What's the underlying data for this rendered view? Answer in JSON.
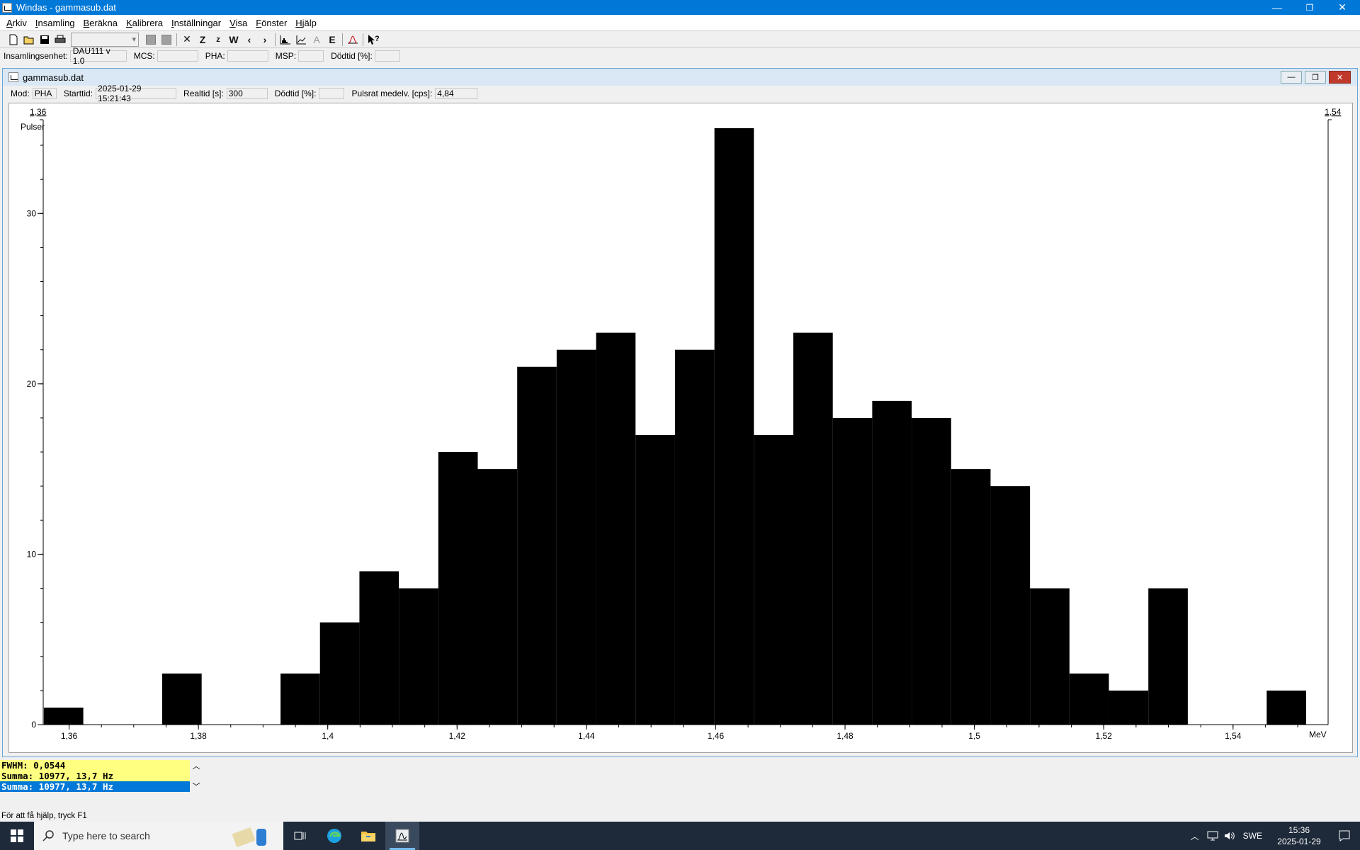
{
  "window": {
    "title": "Windas - gammasub.dat",
    "controls": {
      "minimize": "—",
      "restore": "❐",
      "close": "✕"
    }
  },
  "menu": [
    {
      "label": "Arkiv",
      "key": "A",
      "rest": "rkiv"
    },
    {
      "label": "Insamling",
      "key": "I",
      "rest": "nsamling"
    },
    {
      "label": "Beräkna",
      "key": "B",
      "rest": "eräkna"
    },
    {
      "label": "Kalibrera",
      "key": "K",
      "rest": "alibrera"
    },
    {
      "label": "Inställningar",
      "key": "I",
      "rest": "nställningar"
    },
    {
      "label": "Visa",
      "key": "V",
      "rest": "isa"
    },
    {
      "label": "Fönster",
      "key": "F",
      "rest": "önster"
    },
    {
      "label": "Hjälp",
      "key": "H",
      "rest": "jälp"
    }
  ],
  "toolbar": {
    "glyphs": {
      "x": "✕",
      "Z": "Z",
      "z": "z",
      "W": "W",
      "lt": "‹",
      "gt": "›",
      "A": "A",
      "E": "E",
      "help": "?"
    }
  },
  "infobar": {
    "unit_label": "Insamlingsenhet:",
    "unit_value": "DAU111 v 1.0",
    "mcs_label": "MCS:",
    "mcs_value": "",
    "pha_label": "PHA:",
    "pha_value": "",
    "msp_label": "MSP:",
    "msp_value": "",
    "dead_label": "Dödtid [%]:",
    "dead_value": ""
  },
  "child": {
    "title": "gammasub.dat",
    "info": {
      "mode_label": "Mod:",
      "mode_value": "PHA",
      "start_label": "Starttid:",
      "start_value": "2025-01-29  15:21:43",
      "real_label": "Realtid [s]:",
      "real_value": "300",
      "dead_label": "Dödtid [%]:",
      "dead_value": "",
      "rate_label": "Pulsrat medelv. [cps]:",
      "rate_value": "4,84"
    }
  },
  "chart_data": {
    "type": "bar",
    "ylabel": "Pulser",
    "xlabel": "MeV",
    "xlim": [
      1.356,
      1.5547
    ],
    "ylim": [
      0,
      35
    ],
    "cursor_left_label": "1,36",
    "cursor_right_label": "1,54",
    "x_ticks": [
      1.36,
      1.38,
      1.4,
      1.42,
      1.44,
      1.46,
      1.48,
      1.5,
      1.52,
      1.54
    ],
    "x_tick_labels": [
      "1,36",
      "1,38",
      "1,4",
      "1,42",
      "1,44",
      "1,46",
      "1,48",
      "1,5",
      "1,52",
      "1,54"
    ],
    "y_ticks": [
      0,
      10,
      20,
      30
    ],
    "y_tick_labels": [
      "0",
      "10",
      "20",
      "30"
    ],
    "bin_width": 0.0061,
    "bins_start": [
      1.3561,
      1.3622,
      1.3683,
      1.3744,
      1.3805,
      1.3866,
      1.3927,
      1.3988,
      1.4049,
      1.411,
      1.4171,
      1.4232,
      1.4293,
      1.4354,
      1.4415,
      1.4476,
      1.4537,
      1.4598,
      1.4659,
      1.472,
      1.4781,
      1.4842,
      1.4903,
      1.4964,
      1.5025,
      1.5086,
      1.5147,
      1.5208,
      1.5269,
      1.533,
      1.5391,
      1.5452
    ],
    "values": [
      1,
      0,
      0,
      3,
      0,
      0,
      3,
      6,
      9,
      8,
      16,
      15,
      21,
      22,
      23,
      17,
      22,
      35,
      17,
      23,
      18,
      19,
      18,
      15,
      14,
      8,
      3,
      2,
      8,
      0,
      0,
      2
    ],
    "bar_color": "#000000"
  },
  "results": {
    "line1": "FWHM: 0,0544",
    "line2": "Summa: 10977,  13,7 Hz",
    "line3": "Summa: 10977,  13,7 Hz"
  },
  "status": "För att få hjälp, tryck F1",
  "taskbar": {
    "search_placeholder": "Type here to search",
    "lang": "SWE",
    "time": "15:36",
    "date": "2025-01-29"
  }
}
